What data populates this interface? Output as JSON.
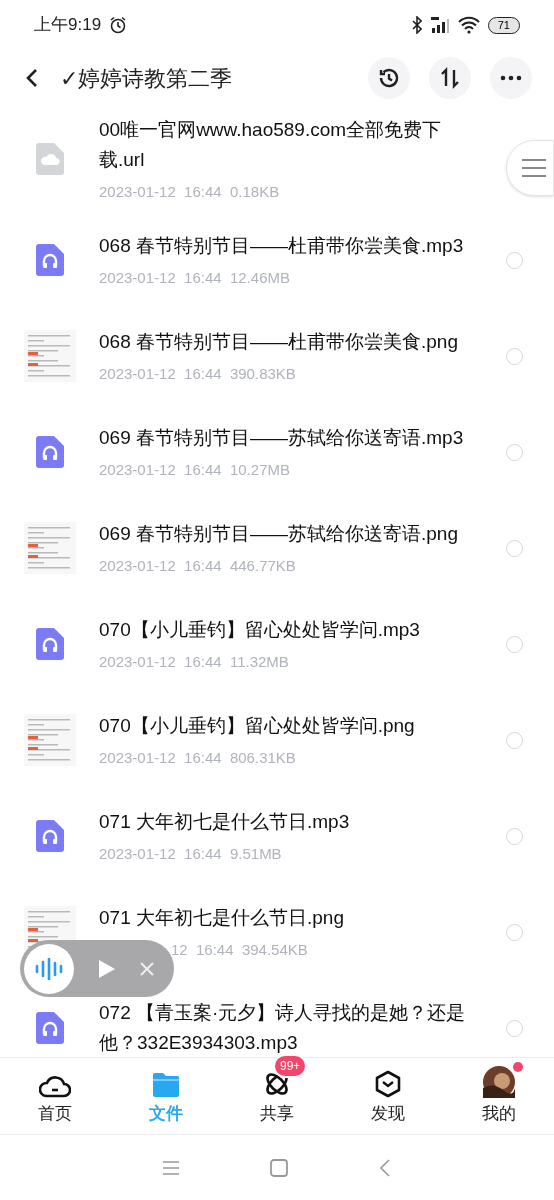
{
  "status_bar": {
    "time": "上午9:19",
    "battery": "71"
  },
  "header": {
    "title": "✓婷婷诗教第二季"
  },
  "files": [
    {
      "kind": "link",
      "name": "00唯一官网www.hao589.com全部免费下载.url",
      "meta": "2023-01-12  16:44  0.18KB",
      "obscured": false
    },
    {
      "kind": "audio",
      "name": "068 春节特别节目——杜甫带你尝美食.mp3",
      "meta": "2023-01-12  16:44  12.46MB",
      "obscured": false,
      "selected": false
    },
    {
      "kind": "image",
      "name": "068 春节特别节目——杜甫带你尝美食.png",
      "meta": "2023-01-12  16:44  390.83KB",
      "obscured": false,
      "selected": false
    },
    {
      "kind": "audio",
      "name": "069 春节特别节目——苏轼给你送寄语.mp3",
      "meta": "2023-01-12  16:44  10.27MB",
      "obscured": false,
      "selected": false
    },
    {
      "kind": "image",
      "name": "069 春节特别节目——苏轼给你送寄语.png",
      "meta": "2023-01-12  16:44  446.77KB",
      "obscured": false,
      "selected": false
    },
    {
      "kind": "audio",
      "name": "070【小儿垂钓】留心处处皆学问.mp3",
      "meta": "2023-01-12  16:44  11.32MB",
      "obscured": false,
      "selected": false
    },
    {
      "kind": "image",
      "name": "070【小儿垂钓】留心处处皆学问.png",
      "meta": "2023-01-12  16:44  806.31KB",
      "obscured": false,
      "selected": false
    },
    {
      "kind": "audio",
      "name": "071 大年初七是什么节日.mp3",
      "meta": "2023-01-12  16:44  9.51MB",
      "obscured": false,
      "selected": false
    },
    {
      "kind": "image",
      "name": "071 大年初七是什么节日.png",
      "meta": "12  16:44  394.54KB",
      "obscured": true,
      "selected": false
    },
    {
      "kind": "audio",
      "name": "072 【青玉案·元夕】诗人寻找的是她？还是他？332E3934303.mp3",
      "selected": false
    }
  ],
  "tabs": [
    {
      "kind": "home",
      "label": "首页",
      "selected": false
    },
    {
      "kind": "files",
      "label": "文件",
      "selected": true
    },
    {
      "kind": "share",
      "label": "共享",
      "selected": false,
      "badge": "99+"
    },
    {
      "kind": "discover",
      "label": "发现",
      "selected": false
    },
    {
      "kind": "me",
      "label": "我的",
      "selected": false,
      "dot": true
    }
  ]
}
